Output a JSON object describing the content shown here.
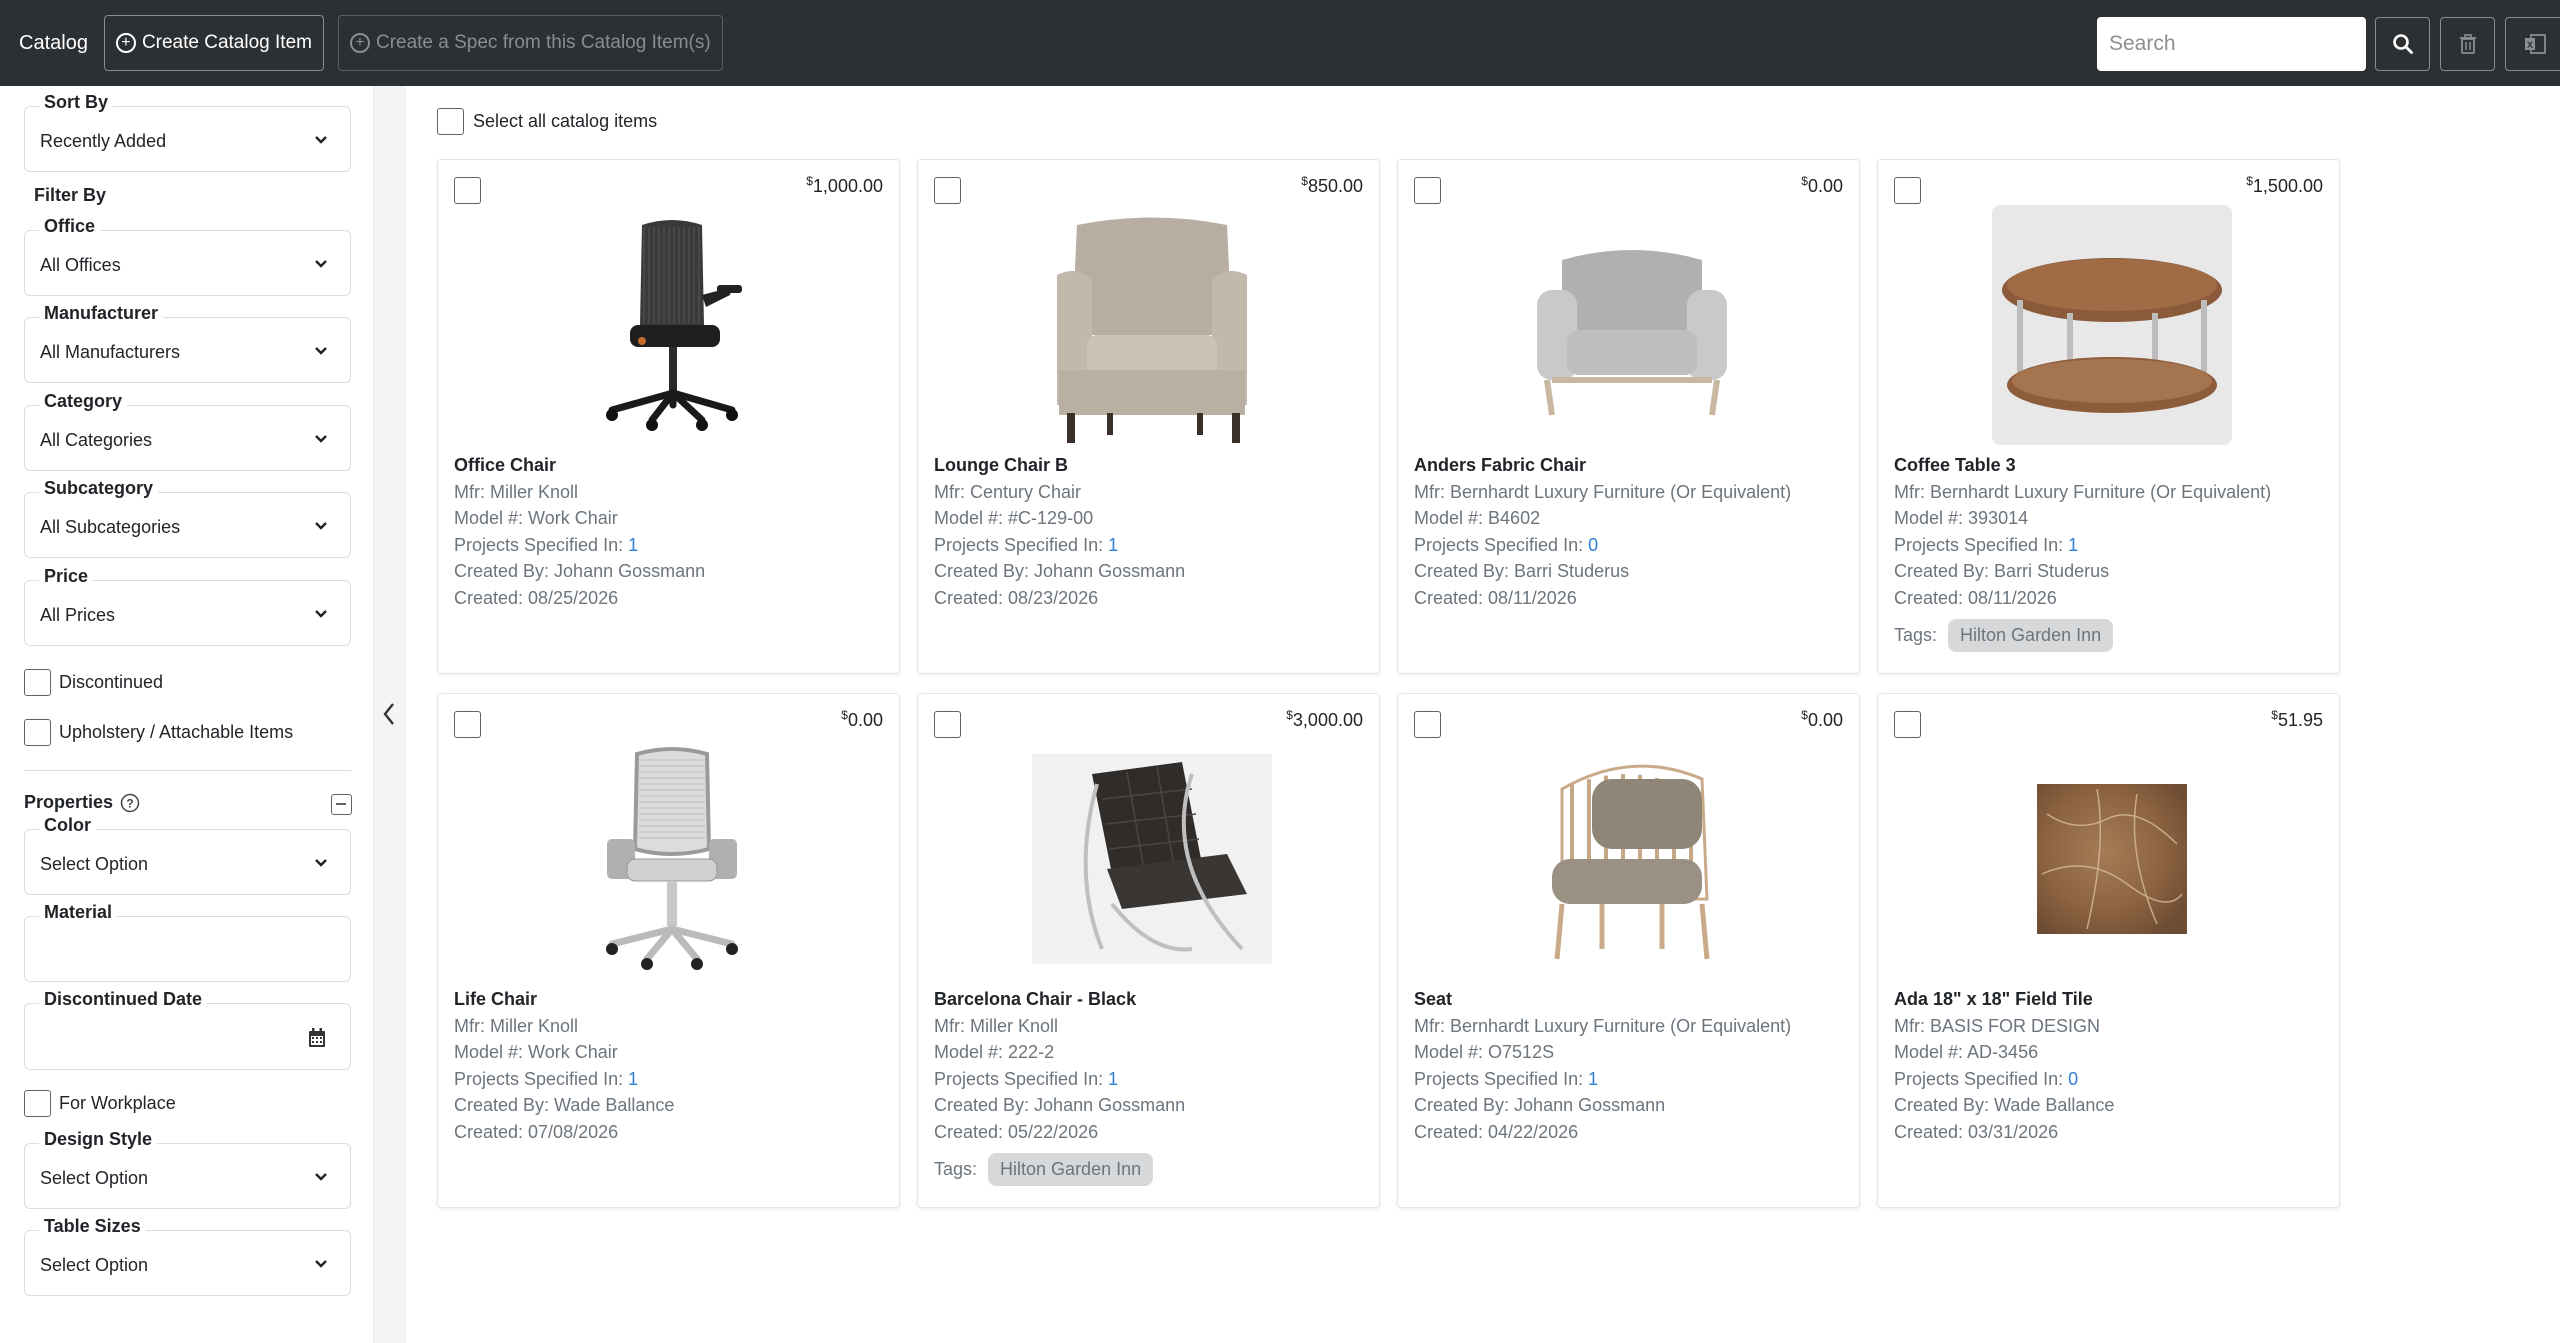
{
  "header": {
    "title": "Catalog",
    "create_button": "Create Catalog Item",
    "create_spec_button": "Create a Spec from this Catalog Item(s)",
    "search_placeholder": "Search"
  },
  "sidebar": {
    "sort": {
      "label": "Sort By",
      "value": "Recently Added"
    },
    "filter_by": "Filter By",
    "filters": [
      {
        "label": "Office",
        "value": "All Offices"
      },
      {
        "label": "Manufacturer",
        "value": "All Manufacturers"
      },
      {
        "label": "Category",
        "value": "All Categories"
      },
      {
        "label": "Subcategory",
        "value": "All Subcategories"
      },
      {
        "label": "Price",
        "value": "All Prices"
      }
    ],
    "checks": [
      "Discontinued",
      "Upholstery / Attachable Items"
    ],
    "properties_title": "Properties",
    "color": {
      "label": "Color",
      "value": "Select Option"
    },
    "material": {
      "label": "Material",
      "value": ""
    },
    "discontinued_date": {
      "label": "Discontinued Date",
      "value": ""
    },
    "for_workplace": "For Workplace",
    "design_style": {
      "label": "Design Style",
      "value": "Select Option"
    },
    "table_sizes": {
      "label": "Table Sizes",
      "value": "Select Option"
    }
  },
  "main": {
    "select_all": "Select all catalog items",
    "tags_label": "Tags:",
    "items": [
      {
        "price_sym": "$",
        "price": "1,000.00",
        "name": "Office Chair",
        "mfr": "Mfr: Miller Knoll",
        "model": "Model #: Work Chair",
        "projects_label": "Projects Specified In: ",
        "projects": "1",
        "created_by": "Created By: Johann Gossmann",
        "created": "Created: 08/25/2026",
        "tag": ""
      },
      {
        "price_sym": "$",
        "price": "850.00",
        "name": "Lounge Chair B",
        "mfr": "Mfr: Century Chair",
        "model": "Model #: #C-129-00",
        "projects_label": "Projects Specified In: ",
        "projects": "1",
        "created_by": "Created By: Johann Gossmann",
        "created": "Created: 08/23/2026",
        "tag": ""
      },
      {
        "price_sym": "$",
        "price": "0.00",
        "name": "Anders Fabric Chair",
        "mfr": "Mfr: Bernhardt Luxury Furniture (Or Equivalent)",
        "model": "Model #: B4602",
        "projects_label": "Projects Specified In: ",
        "projects": "0",
        "created_by": "Created By: Barri Studerus",
        "created": "Created: 08/11/2026",
        "tag": ""
      },
      {
        "price_sym": "$",
        "price": "1,500.00",
        "name": "Coffee Table 3",
        "mfr": "Mfr: Bernhardt Luxury Furniture (Or Equivalent)",
        "model": "Model #: 393014",
        "projects_label": "Projects Specified In: ",
        "projects": "1",
        "created_by": "Created By: Barri Studerus",
        "created": "Created: 08/11/2026",
        "tag": "Hilton Garden Inn"
      },
      {
        "price_sym": "$",
        "price": "0.00",
        "name": "Life Chair",
        "mfr": "Mfr: Miller Knoll",
        "model": "Model #: Work Chair",
        "projects_label": "Projects Specified In: ",
        "projects": "1",
        "created_by": "Created By: Wade Ballance",
        "created": "Created: 07/08/2026",
        "tag": ""
      },
      {
        "price_sym": "$",
        "price": "3,000.00",
        "name": "Barcelona Chair - Black",
        "mfr": "Mfr: Miller Knoll",
        "model": "Model #: 222-2",
        "projects_label": "Projects Specified In: ",
        "projects": "1",
        "created_by": "Created By: Johann Gossmann",
        "created": "Created: 05/22/2026",
        "tag": "Hilton Garden Inn"
      },
      {
        "price_sym": "$",
        "price": "0.00",
        "name": "Seat",
        "mfr": "Mfr: Bernhardt Luxury Furniture (Or Equivalent)",
        "model": "Model #: O7512S",
        "projects_label": "Projects Specified In: ",
        "projects": "1",
        "created_by": "Created By: Johann Gossmann",
        "created": "Created: 04/22/2026",
        "tag": ""
      },
      {
        "price_sym": "$",
        "price": "51.95",
        "name": "Ada 18\" x 18\" Field Tile",
        "mfr": "Mfr: BASIS FOR DESIGN",
        "model": "Model #: AD-3456",
        "projects_label": "Projects Specified In: ",
        "projects": "0",
        "created_by": "Created By: Wade Ballance",
        "created": "Created: 03/31/2026",
        "tag": ""
      }
    ]
  },
  "colors": {
    "topbar": "#2d3033",
    "link": "#2f7fd6",
    "muted": "#6c757d",
    "tag_bg": "#d7d8da"
  }
}
